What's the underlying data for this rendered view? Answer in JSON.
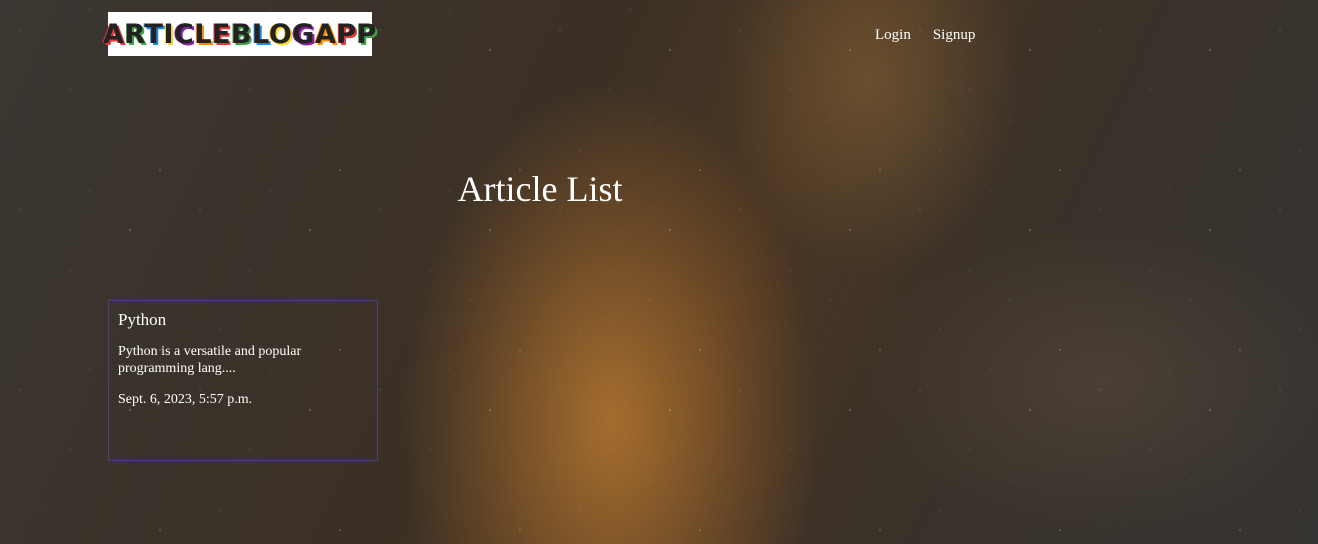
{
  "header": {
    "logo_text": "ARTICLEBLOGAPP",
    "nav": {
      "login_label": "Login",
      "signup_label": "Signup"
    }
  },
  "main": {
    "title": "Article List",
    "articles": [
      {
        "title": "Python",
        "excerpt": "Python is a versatile and popular programming lang....",
        "date": "Sept. 6, 2023, 5:57 p.m."
      }
    ]
  },
  "colors": {
    "card_border": "#4b3f86",
    "text": "#ffffff",
    "logo_letters": [
      "#e53935",
      "#43a047",
      "#1e88e5",
      "#fdd835",
      "#8e24aa",
      "#fb8c00"
    ]
  }
}
